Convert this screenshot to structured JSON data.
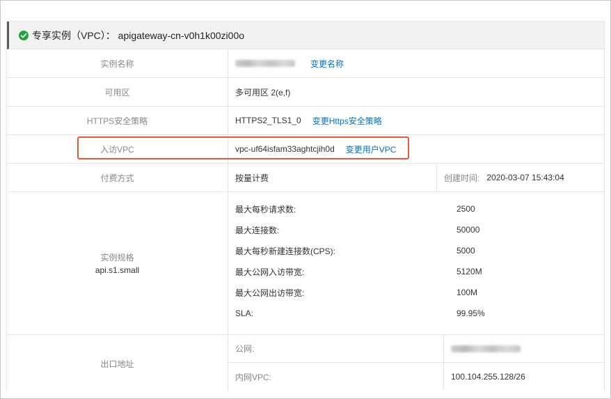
{
  "header": {
    "title": "专享实例（VPC）： apigateway-cn-v0h1k00zi00o",
    "status_color": "#1fa33a"
  },
  "rows": {
    "name": {
      "label": "实例名称",
      "action": "变更名称"
    },
    "zone": {
      "label": "可用区",
      "value": "多可用区 2(e,f)"
    },
    "https": {
      "label": "HTTPS安全策略",
      "value": "HTTPS2_TLS1_0",
      "action": "变更Https安全策略"
    },
    "vpc": {
      "label": "入访VPC",
      "value": "vpc-uf64isfam33aghtcjih0d",
      "action": "变更用户VPC"
    },
    "billing": {
      "label": "付费方式",
      "value": "按量计费",
      "created_label": "创建时间:",
      "created_value": "2020-03-07 15:43:04"
    },
    "spec": {
      "label": "实例规格",
      "sub": "api.s1.small",
      "items": [
        {
          "name": "最大每秒请求数:",
          "value": "2500"
        },
        {
          "name": "最大连接数:",
          "value": "50000"
        },
        {
          "name": "最大每秒新建连接数(CPS):",
          "value": "5000"
        },
        {
          "name": "最大公网入访带宽:",
          "value": "5120M"
        },
        {
          "name": "最大公网出访带宽:",
          "value": "100M"
        },
        {
          "name": "SLA:",
          "value": "99.95%"
        }
      ]
    },
    "egress": {
      "label": "出口地址",
      "public_label": "公网:",
      "internal_label": "内网VPC:",
      "internal_value": "100.104.255.128/26"
    }
  },
  "colors": {
    "link": "#0070cc",
    "highlight": "#e8593a"
  }
}
